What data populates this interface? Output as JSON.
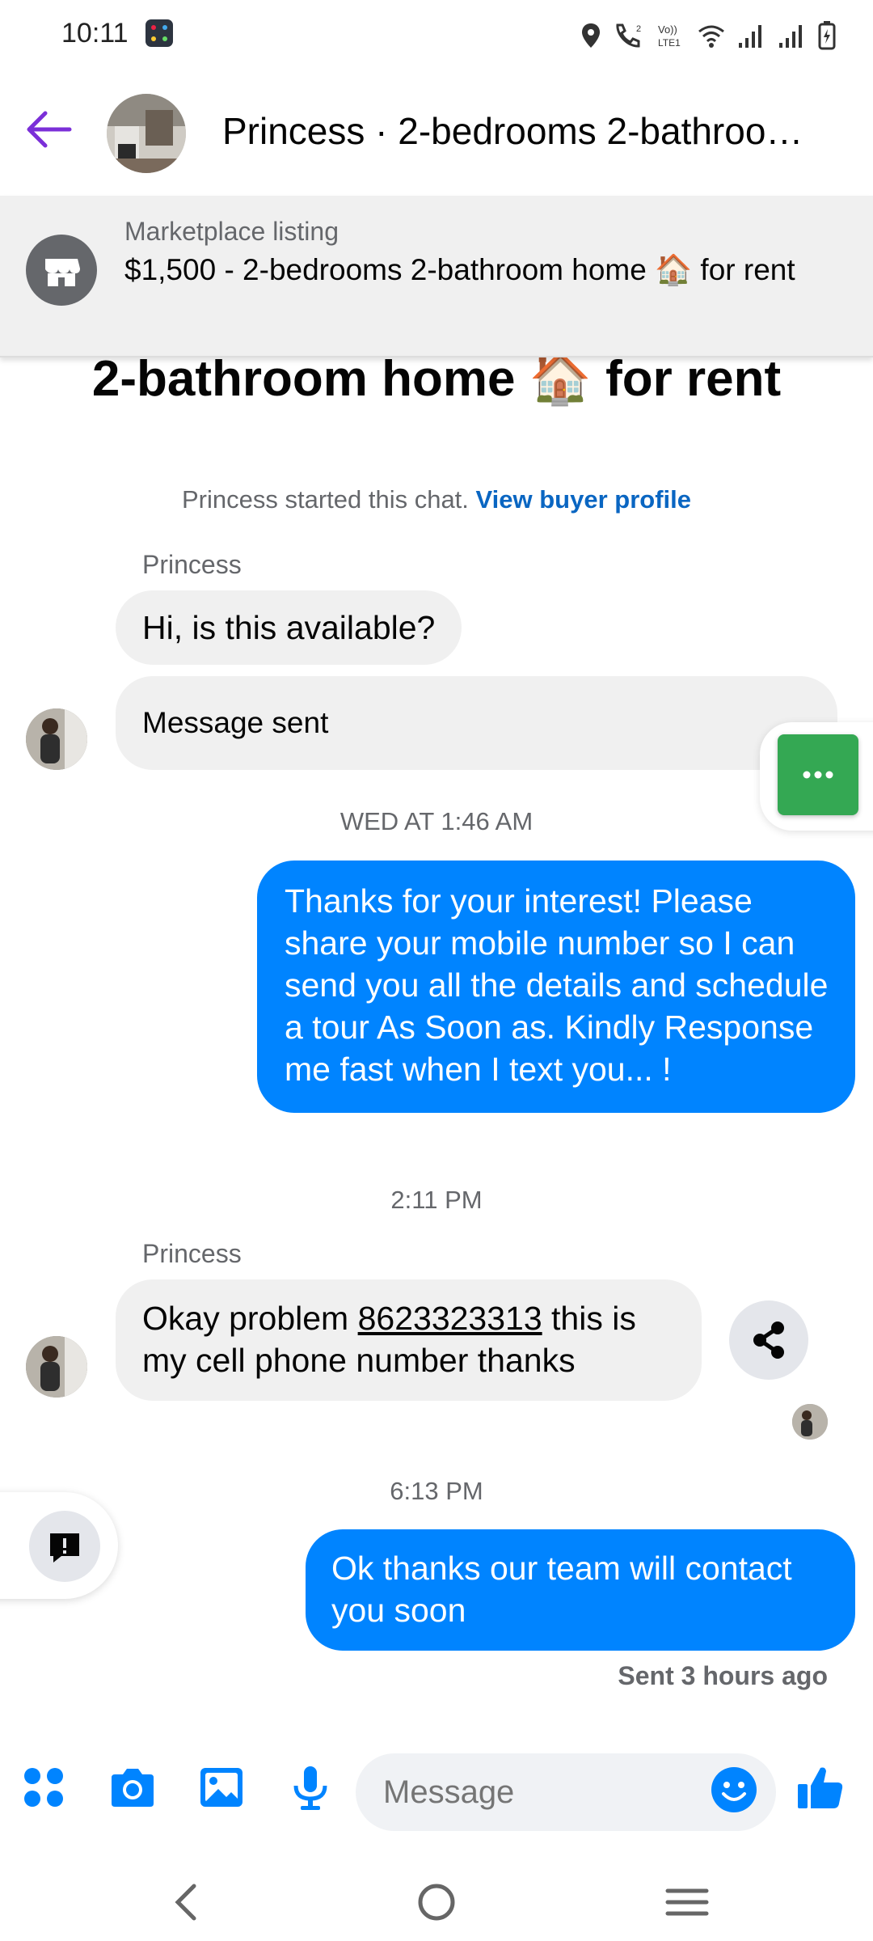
{
  "status_bar": {
    "time": "10:11"
  },
  "header": {
    "title": "Princess · 2-bedrooms 2-bathroo…"
  },
  "listing": {
    "label": "Marketplace listing",
    "title": "$1,500 - 2-bedrooms 2-bathroom home 🏠 for rent"
  },
  "big_title": "2-bathroom home 🏠 for rent",
  "chat_start": {
    "text": "Princess started this chat.",
    "link": "View buyer profile"
  },
  "messages": [
    {
      "sender": "Princess",
      "text": "Hi, is this available?"
    },
    {
      "text": "Message sent"
    },
    {
      "timestamp": "WED AT 1:46 AM"
    },
    {
      "text": "Thanks for your interest! Please share your mobile number so I can send you all the details and schedule a tour As Soon as. Kindly Response me fast when I text you... !"
    },
    {
      "timestamp": "2:11 PM"
    },
    {
      "sender": "Princess",
      "text_before": "Okay problem ",
      "phone": "8623323313",
      "text_after": " this is my cell phone number thanks"
    },
    {
      "timestamp": "6:13 PM"
    },
    {
      "text": "Ok thanks our team will contact you soon"
    }
  ],
  "sent_status": "Sent 3 hours ago",
  "composer": {
    "placeholder": "Message"
  },
  "colors": {
    "accent": "#0084ff",
    "back_arrow": "#7b2fd8",
    "green_fab": "#34a853"
  }
}
